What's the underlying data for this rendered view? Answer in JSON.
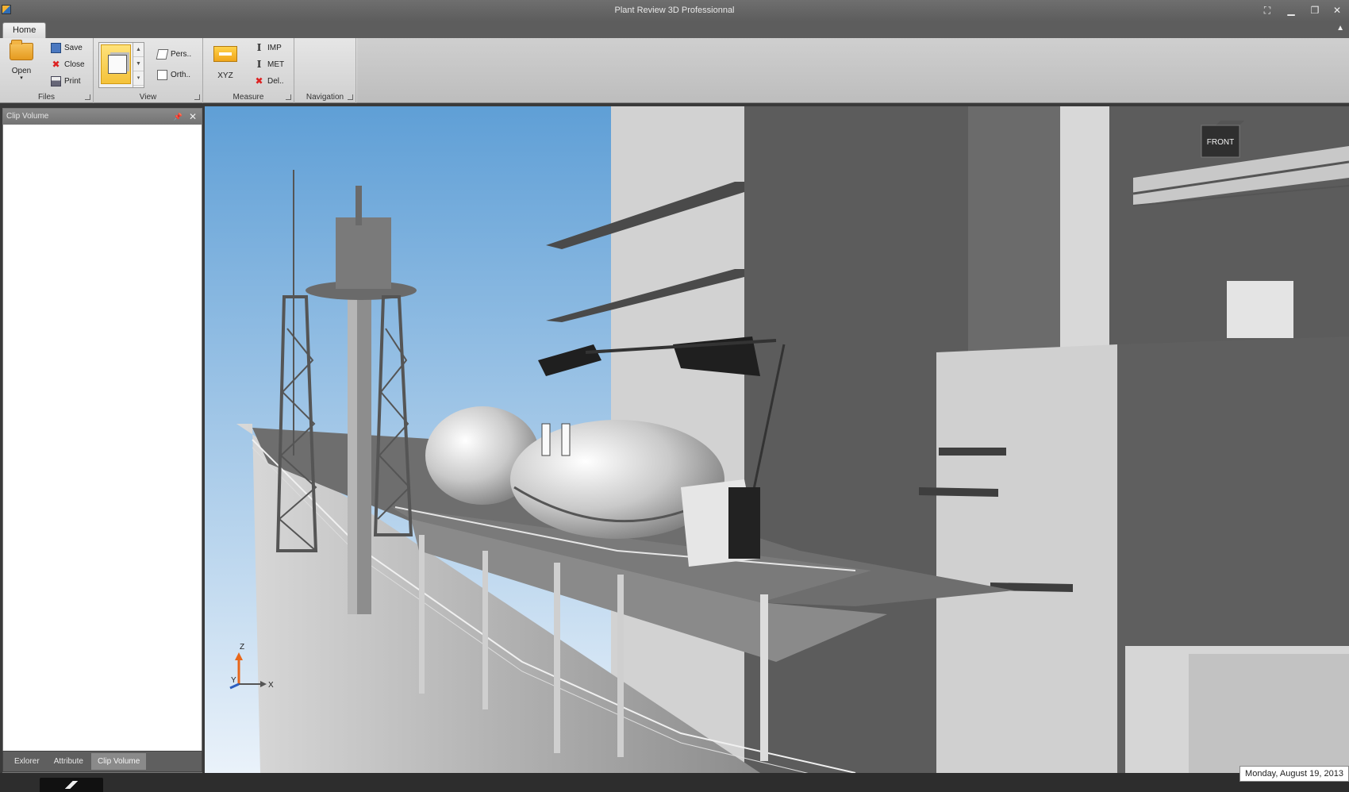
{
  "window": {
    "title": "Plant Review 3D Professionnal"
  },
  "ribbon": {
    "tabs": [
      {
        "label": "Home"
      }
    ],
    "groups": {
      "files": {
        "label": "Files",
        "open_label": "Open",
        "save_label": "Save",
        "close_label": "Close",
        "print_label": "Print"
      },
      "view": {
        "label": "View",
        "perspective_label": "Pers..",
        "orthographic_label": "Orth.."
      },
      "measure": {
        "label": "Measure",
        "xyz_label": "XYZ",
        "imp_label": "IMP",
        "met_label": "MET",
        "delete_label": "Del.."
      },
      "navigation": {
        "label": "Navigation"
      }
    }
  },
  "left_panel": {
    "title": "Clip Volume",
    "tabs": [
      {
        "label": "Exlorer",
        "active": false
      },
      {
        "label": "Attribute",
        "active": false
      },
      {
        "label": "Clip Volume",
        "active": true
      }
    ]
  },
  "viewport": {
    "view_cube_label": "FRONT",
    "axis_labels": {
      "z": "Z",
      "x": "X",
      "y": "Y"
    }
  },
  "status": {
    "date": "Monday, August 19, 2013"
  },
  "colors": {
    "sky_top": "#5f9fd6",
    "sky_bottom": "#eaf2fa",
    "ribbon_highlight": "#f4c23a"
  }
}
